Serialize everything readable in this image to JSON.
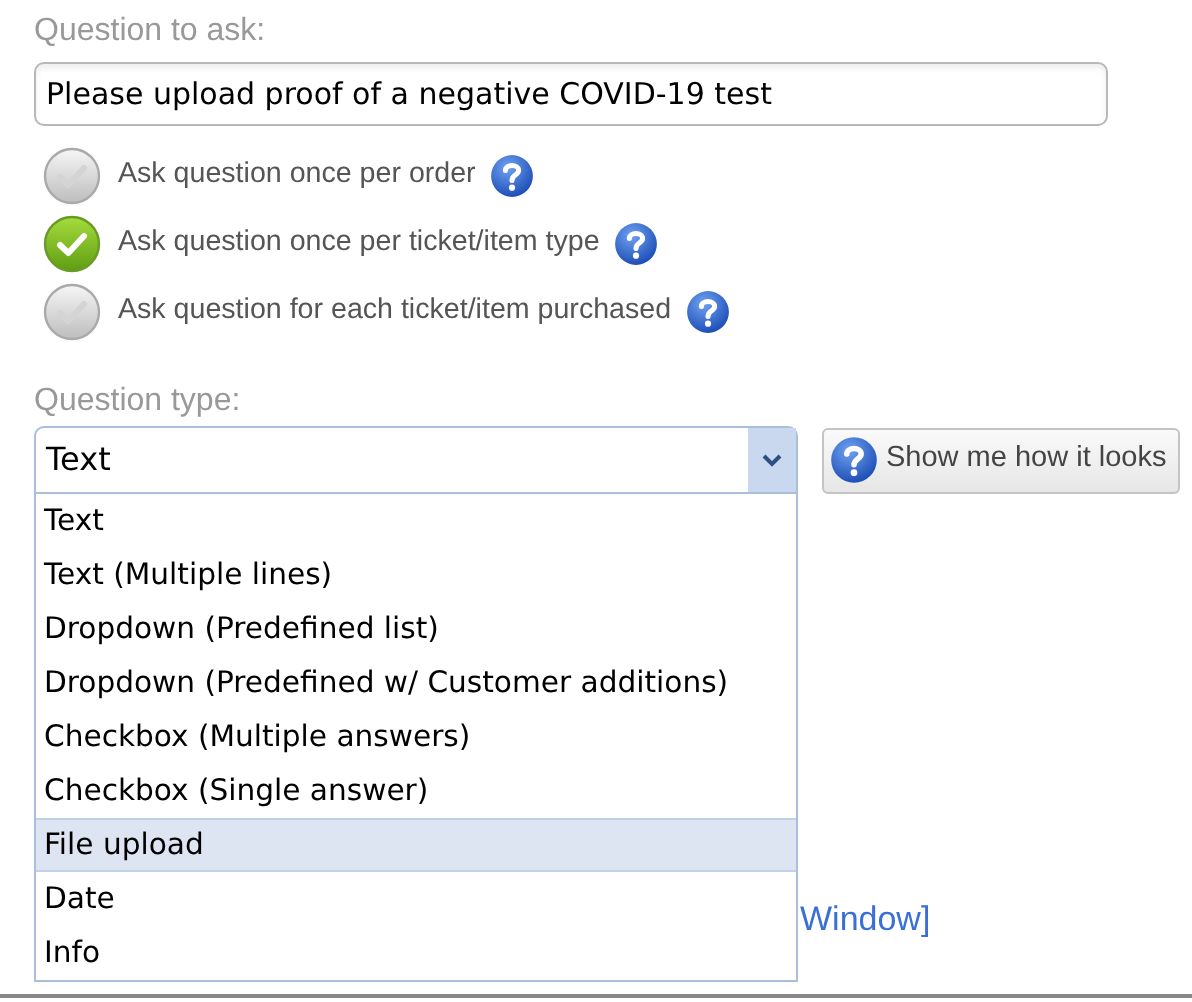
{
  "question_label": "Question to ask:",
  "question_value": "Please upload proof of a negative COVID-19 test",
  "scope_options": [
    {
      "label": "Ask question once per order",
      "selected": false
    },
    {
      "label": "Ask question once per ticket/item type",
      "selected": true
    },
    {
      "label": "Ask question for each ticket/item purchased",
      "selected": false
    }
  ],
  "type_label": "Question type:",
  "type_select": {
    "value": "Text",
    "expanded": true,
    "options": [
      {
        "label": "Text",
        "highlighted": false
      },
      {
        "label": "Text (Multiple lines)",
        "highlighted": false
      },
      {
        "label": "Dropdown (Predefined list)",
        "highlighted": false
      },
      {
        "label": "Dropdown (Predefined w/ Customer additions)",
        "highlighted": false
      },
      {
        "label": "Checkbox (Multiple answers)",
        "highlighted": false
      },
      {
        "label": "Checkbox (Single answer)",
        "highlighted": false
      },
      {
        "label": "File upload",
        "highlighted": true
      },
      {
        "label": "Date",
        "highlighted": false
      },
      {
        "label": "Info",
        "highlighted": false
      }
    ]
  },
  "preview_button": "Show me how it looks",
  "link": "Window]"
}
